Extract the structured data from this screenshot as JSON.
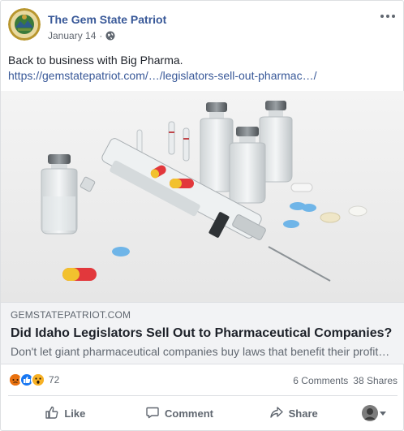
{
  "post": {
    "page_name": "The Gem State Patriot",
    "date": "January 14",
    "separator": "·",
    "privacy_icon": "globe-icon",
    "more_icon": "ellipsis-icon",
    "message": "Back to business with Big Pharma.",
    "link_text": "https://gemstatepatriot.com/…/legislators-sell-out-pharmac…/"
  },
  "link_preview": {
    "domain": "GEMSTATEPATRIOT.COM",
    "headline": "Did Idaho Legislators Sell Out to Pharmaceutical Companies?",
    "description": "Don't let giant pharmaceutical companies buy laws that benefit their profit…",
    "image_icon": "syringe-vials-pills-photo"
  },
  "stats": {
    "reaction_icons": [
      "angry-icon",
      "like-icon",
      "wow-icon"
    ],
    "reaction_count": "72",
    "comments": "6 Comments",
    "shares": "38 Shares"
  },
  "actions": {
    "like": "Like",
    "comment": "Comment",
    "share": "Share"
  },
  "colors": {
    "link_blue": "#385898",
    "meta_gray": "#606770",
    "like_blue": "#1877f2",
    "angry_orange": "#e9710f",
    "wow_yellow": "#f7b125"
  }
}
